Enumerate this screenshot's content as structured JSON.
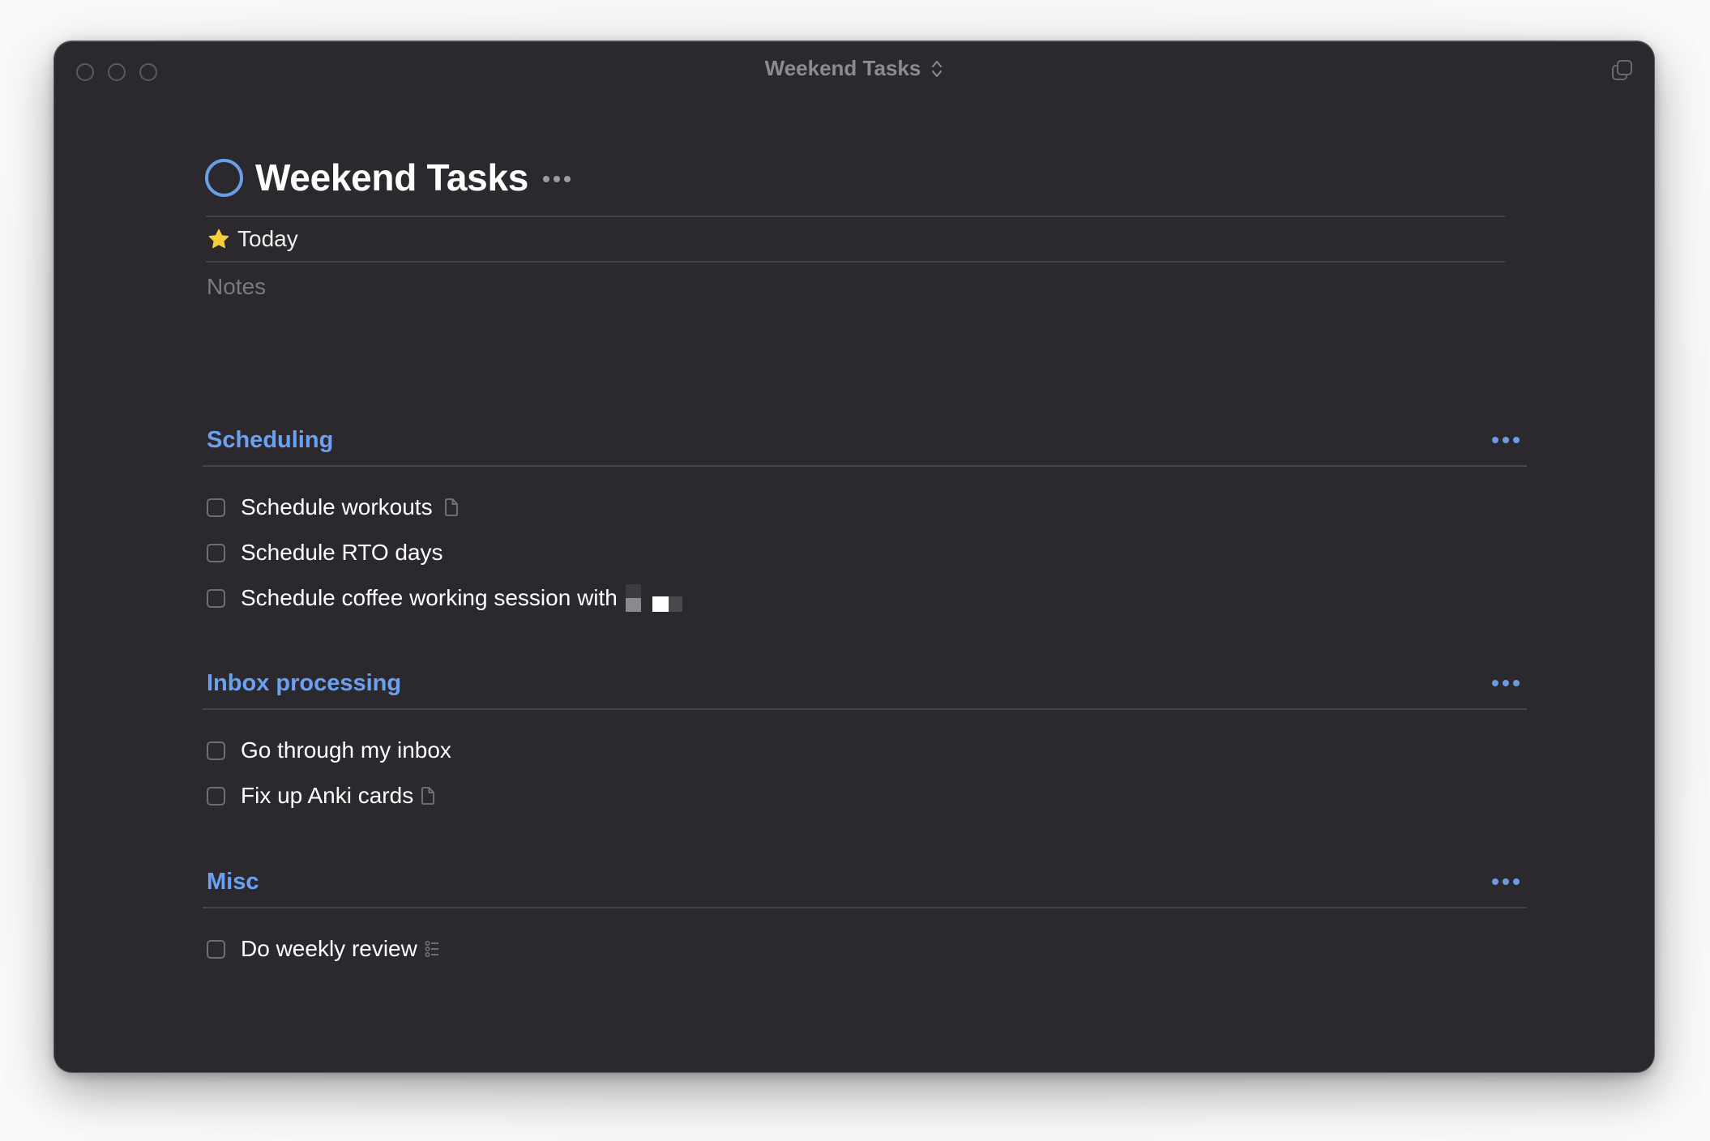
{
  "window": {
    "title": "Weekend Tasks",
    "title_icon": "chevron-up-down-icon",
    "traffic_lights": [
      "close",
      "minimize",
      "zoom"
    ],
    "window_action_icon": "duplicate-window-icon"
  },
  "project": {
    "title": "Weekend Tasks",
    "status_icon": "project-ring-icon",
    "more_icon": "ellipsis-icon",
    "when": {
      "icon": "star-icon",
      "label": "Today"
    },
    "notes_placeholder": "Notes"
  },
  "colors": {
    "background": "#2b292d",
    "accent": "#6aa1f2",
    "star": "#f5cf3a",
    "text": "#ffffff",
    "muted": "#7c7a7e"
  },
  "sections": [
    {
      "title": "Scheduling",
      "more_icon": "ellipsis-icon",
      "tasks": [
        {
          "label": "Schedule workouts",
          "icon": "note-icon",
          "checked": false
        },
        {
          "label": "Schedule RTO days",
          "icon": null,
          "checked": false
        },
        {
          "label": "Schedule coffee working session with",
          "icon": null,
          "redacted_suffix": true,
          "checked": false
        }
      ]
    },
    {
      "title": "Inbox processing",
      "more_icon": "ellipsis-icon",
      "tasks": [
        {
          "label": "Go through my inbox",
          "icon": null,
          "checked": false
        },
        {
          "label": "Fix up Anki cards",
          "icon": "note-icon",
          "checked": false
        }
      ]
    },
    {
      "title": "Misc",
      "more_icon": "ellipsis-icon",
      "tasks": [
        {
          "label": "Do weekly review",
          "icon": "checklist-icon",
          "checked": false
        }
      ]
    }
  ]
}
